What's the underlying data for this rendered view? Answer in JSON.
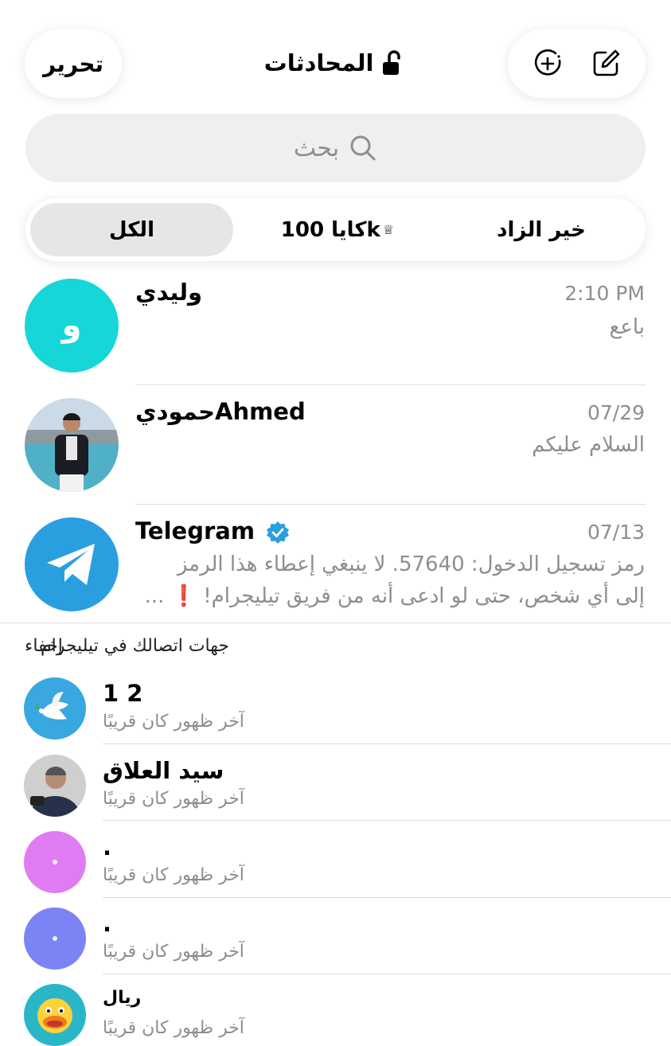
{
  "header": {
    "edit_label": "تحرير",
    "title": "المحادثات",
    "icons": {
      "lock": "unlocked-lock-icon",
      "new_story": "plus-circle-icon",
      "compose": "compose-icon"
    }
  },
  "search": {
    "placeholder": "بحث",
    "icon": "search-icon"
  },
  "filters": {
    "tabs": [
      {
        "label": "خير الزاد"
      },
      {
        "label": "كايا 100k",
        "badge": "♕"
      },
      {
        "label": "الكل",
        "selected": true
      }
    ]
  },
  "chats": [
    {
      "name": "وليدي",
      "time": "2:10 PM",
      "message": "باعع",
      "avatar_letter": "و",
      "avatar_color": "#17d6d8"
    },
    {
      "name": "حموديAhmed",
      "time": "07/29",
      "message": "السلام عليكم"
    },
    {
      "name": "Telegram",
      "time": "07/13",
      "message_line1": "رمز تسجيل الدخول: 57640. لا ينبغي إعطاء هذا الرمز",
      "message_line2": "إلى أي شخص، حتى لو ادعى أنه من فريق تيليجرام! ❗ ...",
      "verified": true,
      "avatar_color": "#2a9fe0"
    }
  ],
  "contacts_section": {
    "title": "جهات اتصالك في تيليجرام",
    "hide_label": "إخفاء",
    "contacts": [
      {
        "name": "1 2",
        "status": "آخر ظهور كان قريبًا"
      },
      {
        "name": "سيد العلاق",
        "status": "آخر ظهور كان قريبًا"
      },
      {
        "name": ".",
        "status": "آخر ظهور كان قريبًا",
        "avatar_color": "#e07cf2"
      },
      {
        "name": ".",
        "status": "آخر ظهور كان قريبًا",
        "avatar_color": "#7b83f5"
      },
      {
        "name": "ريال",
        "status": "آخر ظهور كان قريبًا"
      }
    ]
  },
  "colors": {
    "accent": "#2a9fe0",
    "secondary_text": "#8d8d92",
    "badge_red": "#e0202a"
  }
}
